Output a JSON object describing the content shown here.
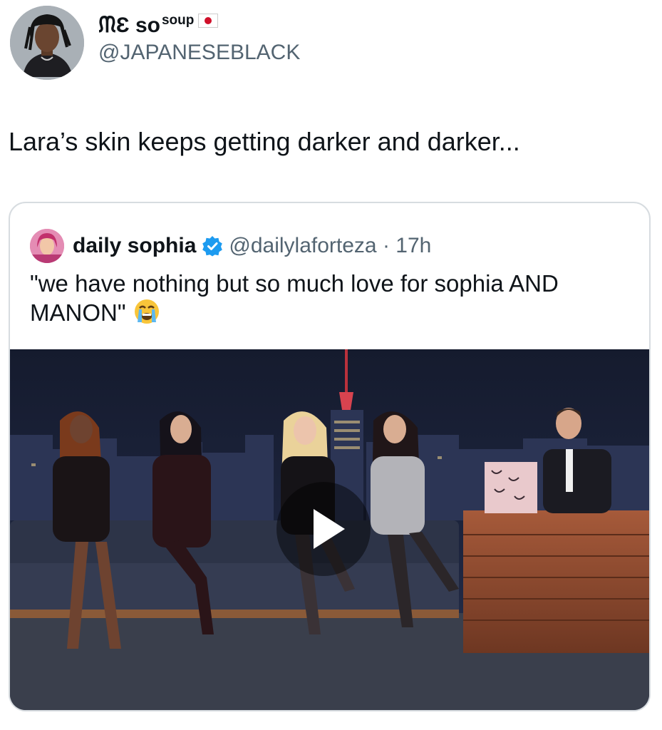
{
  "author": {
    "display_name": "ᙏƐ so",
    "display_name_sup": "soup",
    "handle": "@JAPANESEBLACK",
    "flag_icon": "japan-flag-icon"
  },
  "tweet": {
    "text": "Lara’s skin keeps getting darker and darker..."
  },
  "quoted_tweet": {
    "display_name": "daily sophia",
    "verified_icon": "verified-badge-icon",
    "verified_color": "#1d9bf0",
    "handle_and_time": "@dailylaforteza · 17h",
    "text": "\"we have nothing but so much love for sophia AND MANON\"",
    "emoji": "loudly-crying-face-icon",
    "media": {
      "type": "video",
      "play_icon": "play-icon"
    }
  }
}
